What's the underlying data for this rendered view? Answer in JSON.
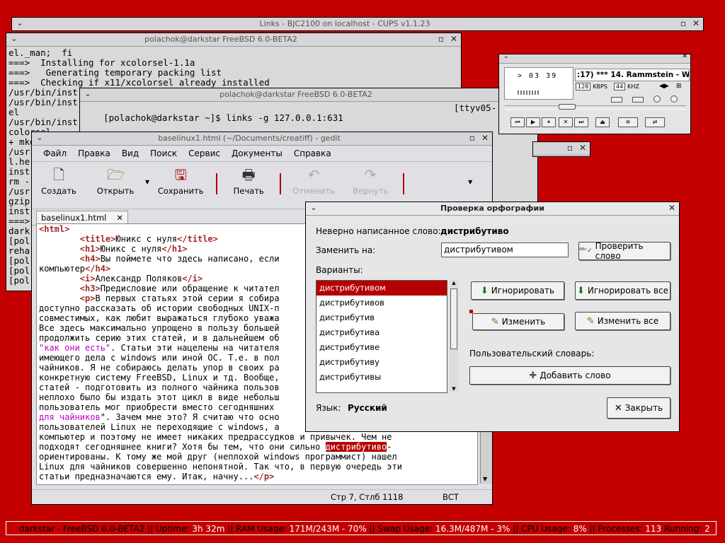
{
  "links_window": {
    "title": "Links - BJC2100 on localhost - CUPS v1.1.23"
  },
  "term1": {
    "title": "polachok@darkstar FreeBSD 6.0-BETA2",
    "lines": [
      "el._man;  fi",
      "===>  Installing for xcolorsel-1.1a",
      "===>   Generating temporary packing list",
      "===>  Checking if x11/xcolorsel already installed",
      "/usr/bin/inst",
      "/usr/bin/inst",
      "el",
      "/usr/bin/inst",
      "colorsel",
      "+ mkd",
      "/usr",
      "l.he",
      "inst",
      "rm -",
      "/usr",
      "gzip",
      "inst",
      "===>",
      "dark",
      "[pol",
      "reha",
      "[pol",
      "[pol",
      "[pol"
    ]
  },
  "term2": {
    "title": "polachok@darkstar FreeBSD 6.0-BETA2",
    "prompt": "[polachok@darkstar ~]$ links -g 127.0.0.1:631",
    "tty": "[ttyv05-"
  },
  "gedit": {
    "title": "baselinux1.html (~/Documents/creatiff) - gedit",
    "menu": [
      "Файл",
      "Правка",
      "Вид",
      "Поиск",
      "Сервис",
      "Документы",
      "Справка"
    ],
    "toolbar": {
      "create": "Создать",
      "open": "Открыть",
      "save": "Сохранить",
      "print": "Печать",
      "undo": "Отменить",
      "redo": "Вернуть"
    },
    "tab": "baselinux1.html",
    "status_pos": "Стр 7, Стлб 1118",
    "status_mode": "ВСТ"
  },
  "code_lines": [
    [
      {
        "t": "<html>",
        "c": "tag"
      }
    ],
    [
      {
        "t": "        "
      },
      {
        "t": "<title>",
        "c": "tag"
      },
      {
        "t": "Юникс с нуля"
      },
      {
        "t": "</title>",
        "c": "tag"
      }
    ],
    [
      {
        "t": "        "
      },
      {
        "t": "<h1>",
        "c": "tag"
      },
      {
        "t": "Юникс с нуля"
      },
      {
        "t": "</h1>",
        "c": "tag"
      }
    ],
    [
      {
        "t": "        "
      },
      {
        "t": "<h4>",
        "c": "tag"
      },
      {
        "t": "Вы поймете что здесь написано, если"
      }
    ],
    [
      {
        "t": "компьютер"
      },
      {
        "t": "</h4>",
        "c": "tag"
      }
    ],
    [
      {
        "t": "        "
      },
      {
        "t": "<i>",
        "c": "tag"
      },
      {
        "t": "Александр Поляков"
      },
      {
        "t": "</i>",
        "c": "tag"
      }
    ],
    [
      {
        "t": "        "
      },
      {
        "t": "<h3>",
        "c": "tag"
      },
      {
        "t": "Предисловие или обращение к читател"
      }
    ],
    [
      {
        "t": "        "
      },
      {
        "t": "<p>",
        "c": "tag"
      },
      {
        "t": "В первых статьях этой серии я собира"
      }
    ],
    [
      {
        "t": "доступно рассказать об истории свободных UNIX-п"
      }
    ],
    [
      {
        "t": "совместимых, как любит выражаться глубоко уважа"
      }
    ],
    [
      {
        "t": "Все здесь максимально упрощено в пользу большей"
      }
    ],
    [
      {
        "t": "продолжить серию этих статей, и в дальнейшем об"
      }
    ],
    [
      {
        "t": "\"как они есть\"",
        "c": "str"
      },
      {
        "t": ". Статьи эти нацелены на читателя"
      }
    ],
    [
      {
        "t": "имеющего дела с windows или иной ОС. Т.е. в пол"
      }
    ],
    [
      {
        "t": "чайников. Я не собираюсь делать упор в своих ра"
      }
    ],
    [
      {
        "t": "конкретную систему FreeBSD, Linux и тд. Вообще,"
      }
    ],
    [
      {
        "t": "статей - подготовить из полного чайника пользов"
      }
    ],
    [
      {
        "t": "неплохо было бы издать этот цикл в виде небольш"
      }
    ],
    [
      {
        "t": "пользователь мог приобрести вместо сегодняшних "
      }
    ],
    [
      {
        "t": "для чайников",
        "c": "str"
      },
      {
        "t": "\". Зачем мне это? Я считаю что осно"
      }
    ],
    [
      {
        "t": "пользователей Linux не переходящие с windows, а"
      }
    ],
    [
      {
        "t": "компьютер и поэтому не имеет никаких предрассудков и привычек. Чем не"
      }
    ],
    [
      {
        "t": "подходят сегодняшнее книги? Хотя бы тем, что они сильно "
      },
      {
        "t": "дистрибутиво",
        "c": "hl"
      },
      {
        "t": "-"
      }
    ],
    [
      {
        "t": "ориентированы. К тому же мой друг (неплохой windows программист) нашел"
      }
    ],
    [
      {
        "t": "Linux для чайников совершенно непонятной. Так что, в первую очередь эти"
      }
    ],
    [
      {
        "t": "статьи предназначаются ему. Итак, начну..."
      },
      {
        "t": "</p>",
        "c": "tag"
      }
    ]
  ],
  "spell": {
    "title": "Проверка орфографии",
    "misspelled_label": "Неверно написанное слово:",
    "misspelled_word": "дистрибутиво",
    "replace_label": "Заменить на:",
    "replace_value": "дистрибутивом",
    "check_word": "Проверить слово",
    "variants_label": "Варианты:",
    "variants": [
      "дистрибутивом",
      "дистрибутивов",
      "дистрибутив",
      "дистрибутива",
      "дистрибутиве",
      "дистрибутиву",
      "дистрибутивы"
    ],
    "ignore": "Игнорировать",
    "ignore_all": "Игнорировать все",
    "change": "Изменить",
    "change_all": "Изменить все",
    "user_dict_label": "Пользовательский словарь:",
    "add_word": "Добавить слово",
    "lang_label": "Язык:",
    "lang_value": "Русский",
    "close": "Закрыть"
  },
  "player": {
    "time": "> 03 39",
    "track": ":17) *** 14. Rammstein - W",
    "kbps": "128",
    "kbps_label": "KBPS",
    "khz": "44",
    "khz_label": "KHZ"
  },
  "status": {
    "host": "darkstar - FreeBSD 6.0-BETA2",
    "uptime_label": "Uptime:",
    "uptime": "3h 32m",
    "ram_label": "RAM Usage:",
    "ram": "171M/243M - 70%",
    "swap_label": "Swap Usage:",
    "swap": "16.3M/487M - 3%",
    "cpu_label": "CPU Usage:",
    "cpu": "8%",
    "proc_label": "Processes:",
    "proc": "113",
    "run_label": "Running:",
    "run": "2"
  }
}
